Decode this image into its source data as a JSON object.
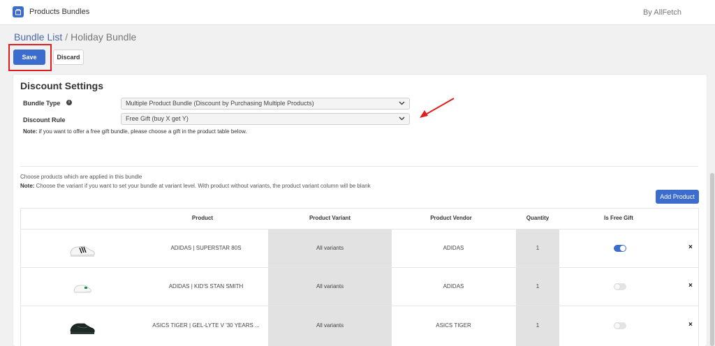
{
  "app": {
    "title": "Products Bundles",
    "brand": "By AllFetch",
    "accent_color": "#3d6ccf"
  },
  "breadcrumb": {
    "parent": "Bundle List",
    "separator": "/",
    "current": "Holiday Bundle"
  },
  "actions": {
    "save_label": "Save",
    "discard_label": "Discard"
  },
  "discount_settings": {
    "title": "Discount Settings",
    "bundle_type_label": "Bundle Type",
    "bundle_type_value": "Multiple Product Bundle (Discount by Purchasing Multiple Products)",
    "discount_rule_label": "Discount Rule",
    "discount_rule_value": "Free Gift (buy X get Y)",
    "note_prefix": "Note:",
    "note_text": " if you want to offer a free gift bundle, please choose a gift in the product table below."
  },
  "products_section": {
    "choose_text": "Choose products which are applied in this bundle",
    "note_prefix": "Note:",
    "note_text": " Choose the variant if you want to set your bundle at variant level. With product without variants, the product variant column will be blank",
    "add_button_label": "Add Product"
  },
  "table": {
    "headers": {
      "product": "Product",
      "variant": "Product Variant",
      "vendor": "Product Vendor",
      "quantity": "Quantity",
      "free_gift": "Is Free Gift"
    },
    "rows": [
      {
        "product": "ADIDAS | SUPERSTAR 80S",
        "variant": "All variants",
        "vendor": "ADIDAS",
        "quantity": "1",
        "is_free_gift": true,
        "image_icon": "white-black-sneaker-icon"
      },
      {
        "product": "ADIDAS | KID'S STAN SMITH",
        "variant": "All variants",
        "vendor": "ADIDAS",
        "quantity": "1",
        "is_free_gift": false,
        "image_icon": "white-green-sneaker-icon"
      },
      {
        "product": "ASICS TIGER | GEL-LYTE V '30 YEARS ...",
        "variant": "All variants",
        "vendor": "ASICS TIGER",
        "quantity": "1",
        "is_free_gift": false,
        "image_icon": "dark-green-sneaker-icon"
      }
    ],
    "remove_symbol": "×"
  },
  "annotations": {
    "highlight_color": "#e11d1d"
  }
}
